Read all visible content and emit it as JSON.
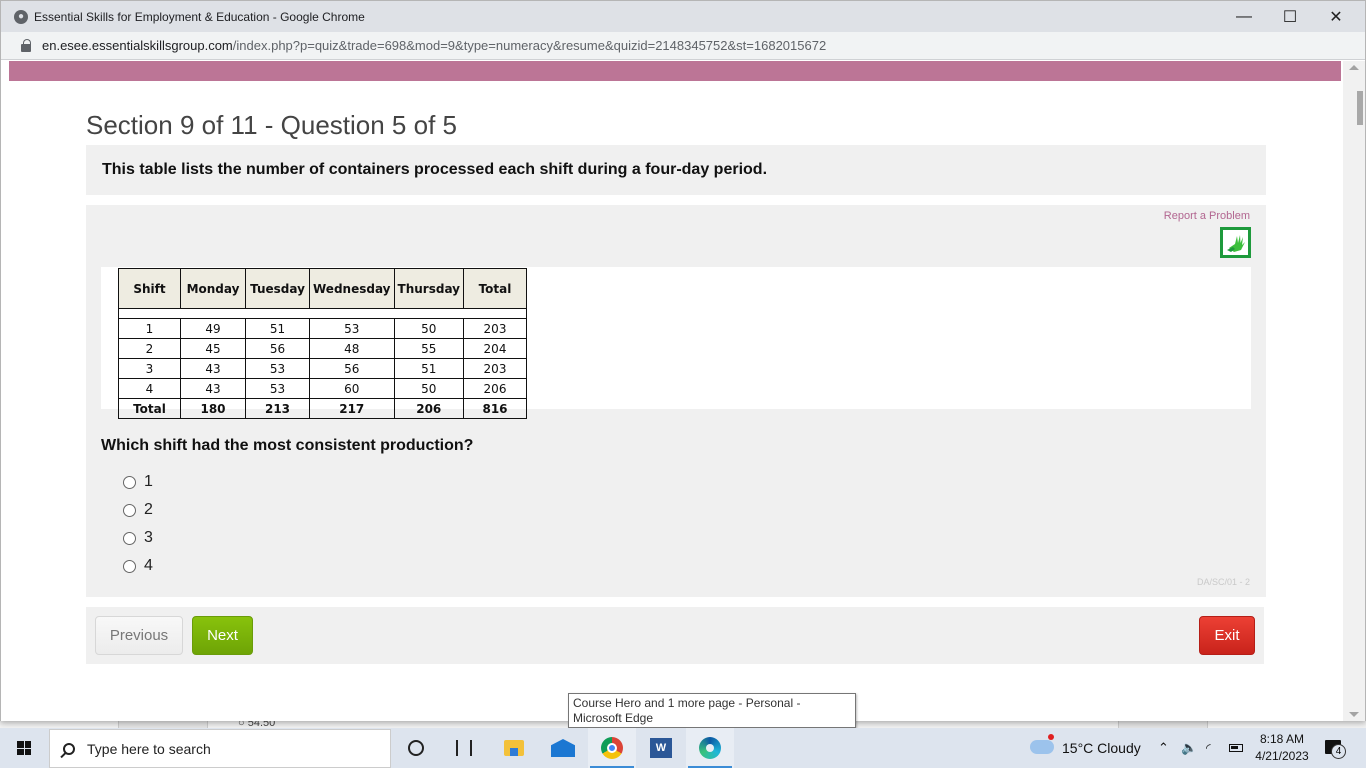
{
  "browser": {
    "window_title": "Essential Skills for Employment & Education - Google Chrome",
    "url_domain": "en.esee.essentialskillsgroup.com",
    "url_path": "/index.php?p=quiz&trade=698&mod=9&type=numeracy&resume&quizid=2148345752&st=1682015672",
    "controls": {
      "minimize": "—",
      "maximize": "☐",
      "close": "✕"
    }
  },
  "page": {
    "section_title": "Section 9 of 11  -  Question 5 of 5",
    "intro": "This table lists the number of containers processed each shift during a four-day period.",
    "report_link": "Report a Problem",
    "sign_language_icon": "hand-sign-icon",
    "question": "Which shift had the most consistent production?",
    "options": [
      "1",
      "2",
      "3",
      "4"
    ],
    "selected_option": null,
    "question_code": "DA/SC/01 - 2",
    "buttons": {
      "previous": "Previous",
      "next": "Next",
      "exit": "Exit"
    },
    "colors": {
      "header_band": "#bc7596",
      "next": "#7ab30a",
      "exit": "#dd3128",
      "report_link": "#b26690"
    }
  },
  "table": {
    "headers": [
      "Shift",
      "Monday",
      "Tuesday",
      "Wednesday",
      "Thursday",
      "Total"
    ],
    "rows": [
      [
        "1",
        "49",
        "51",
        "53",
        "50",
        "203"
      ],
      [
        "2",
        "45",
        "56",
        "48",
        "55",
        "204"
      ],
      [
        "3",
        "43",
        "53",
        "56",
        "51",
        "203"
      ],
      [
        "4",
        "43",
        "53",
        "60",
        "50",
        "206"
      ]
    ],
    "total_row": [
      "Total",
      "180",
      "213",
      "217",
      "206",
      "816"
    ]
  },
  "background_page": {
    "partial_option_text": "54.50"
  },
  "tooltip": {
    "text": "Course Hero and 1 more page - Personal - Microsoft Edge"
  },
  "taskbar": {
    "search_placeholder": "Type here to search",
    "apps": [
      "cortana",
      "task-view",
      "file-explorer",
      "mail",
      "chrome",
      "word",
      "edge"
    ],
    "weather": "15°C  Cloudy",
    "time": "8:18 AM",
    "date": "4/21/2023",
    "notification_count": "4"
  }
}
